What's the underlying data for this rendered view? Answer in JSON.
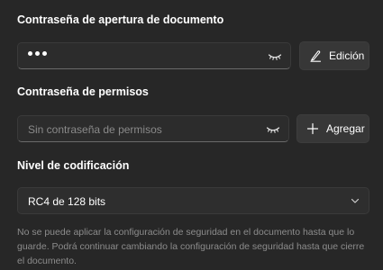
{
  "open_password": {
    "label": "Contraseña de apertura de documento",
    "masked_length": 3,
    "edit_button_label": "Edición"
  },
  "permissions_password": {
    "label": "Contraseña de permisos",
    "placeholder": "Sin contraseña de permisos",
    "add_button_label": "Agregar"
  },
  "encryption": {
    "label": "Nivel de codificación",
    "selected": "RC4 de 128 bits"
  },
  "note": "No se puede aplicar la configuración de seguridad en el documento hasta que lo guarde. Podrá continuar cambiando la configuración de seguridad hasta que cierre el documento."
}
